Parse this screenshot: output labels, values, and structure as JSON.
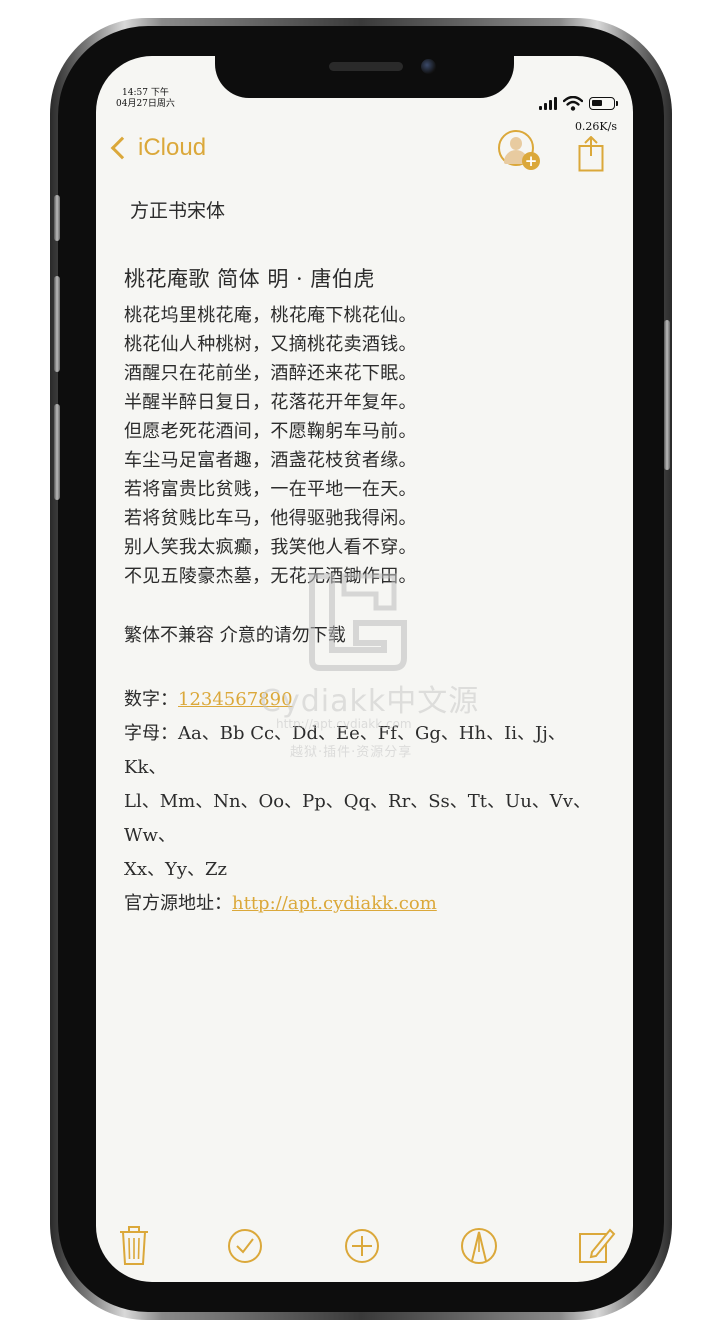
{
  "status_bar": {
    "time": "14:57 下午",
    "date": "04月27日周六",
    "net_speed": "0.26K/s",
    "battery_level": 0.55
  },
  "nav": {
    "back_label": "iCloud",
    "accent_color": "#dba83a"
  },
  "note": {
    "font_name": "方正书宋体",
    "poem_title": "桃花庵歌  简体   明 · 唐伯虎",
    "poem_lines": [
      "桃花坞里桃花庵，桃花庵下桃花仙。",
      "桃花仙人种桃树，又摘桃花卖酒钱。",
      "酒醒只在花前坐，酒醉还来花下眠。",
      "半醒半醉日复日，花落花开年复年。",
      "但愿老死花酒间，不愿鞠躬车马前。",
      "车尘马足富者趣，酒盏花枝贫者缘。",
      "若将富贵比贫贱，一在平地一在天。",
      "若将贫贱比车马，他得驱驰我得闲。",
      "别人笑我太疯癫，我笑他人看不穿。",
      "不见五陵豪杰墓，无花无酒锄作田。"
    ],
    "notice": "繁体不兼容 介意的请勿下载",
    "digits_label": "数字：",
    "digits_value": "1234567890",
    "letters_label": "字母：",
    "letters_line1": "Aa、Bb Cc、Dd、Ee、Ff、Gg、Hh、Ii、Jj、Kk、",
    "letters_line2": "Ll、Mm、Nn、Oo、Pp、Qq、Rr、Ss、Tt、Uu、Vv、Ww、",
    "letters_line3": "Xx、Yy、Zz",
    "source_label": "官方源地址：",
    "source_url": "http://apt.cydiakk.com"
  },
  "watermark": {
    "title": "Cydiakk中文源",
    "url": "http://apt.cydiakk.com",
    "subtitle": "越狱·插件·资源分享"
  },
  "toolbar": {
    "icons": [
      "trash-icon",
      "checklist-icon",
      "add-icon",
      "markup-icon",
      "compose-icon"
    ]
  }
}
